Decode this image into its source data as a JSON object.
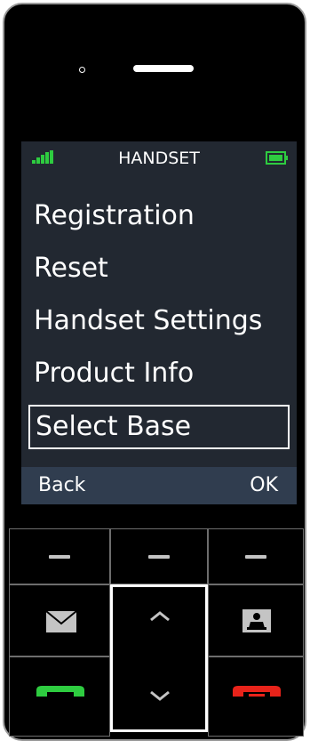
{
  "header": {
    "title": "HANDSET",
    "signal_icon": "signal-bars-icon",
    "battery_icon": "battery-full-icon",
    "accent_color": "#2ecc40"
  },
  "menu": {
    "items": [
      {
        "label": "Registration",
        "selected": false
      },
      {
        "label": "Reset",
        "selected": false
      },
      {
        "label": "Handset Settings",
        "selected": false
      },
      {
        "label": "Product Info",
        "selected": false
      },
      {
        "label": "Select Base",
        "selected": true
      }
    ]
  },
  "softkeys": {
    "left": "Back",
    "right": "OK"
  },
  "keypad": {
    "top_row_icon": "dash-icon",
    "message_icon": "envelope-icon",
    "contacts_icon": "phonebook-icon",
    "up_icon": "chevron-up-icon",
    "down_icon": "chevron-down-icon",
    "call_icon": "call-answer-icon",
    "end_icon": "call-end-icon",
    "call_color": "#2ecc40",
    "end_color": "#e8231a"
  }
}
